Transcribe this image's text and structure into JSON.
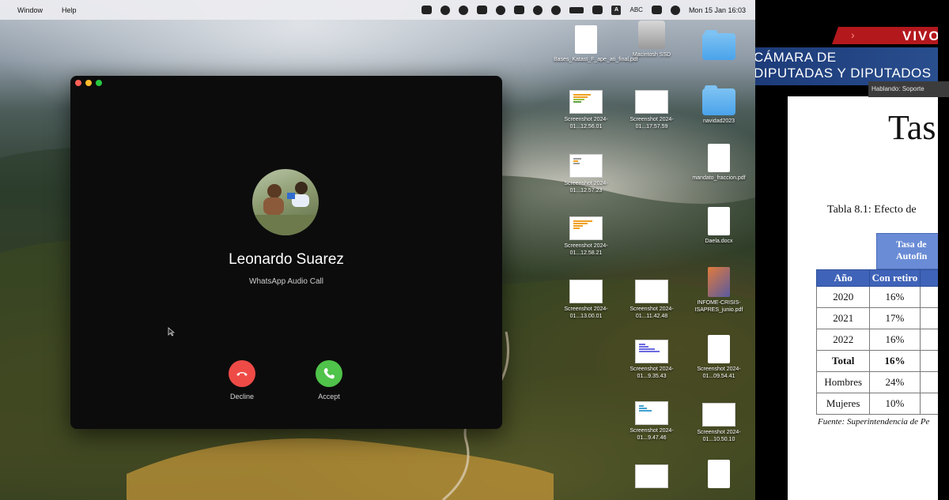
{
  "menubar": {
    "menus": [
      "Window",
      "Help"
    ],
    "input_source": "ABC",
    "clock": "Mon 15 Jan  16:03"
  },
  "call": {
    "caller_name": "Leonardo Suarez",
    "call_type": "WhatsApp Audio Call",
    "decline_label": "Decline",
    "accept_label": "Accept",
    "colors": {
      "decline": "#ee4b47",
      "accept": "#4fc34a"
    }
  },
  "desktop_icons": [
    {
      "kind": "doc",
      "label": "Bases_Katast_F_ape_ati_final.pdf"
    },
    {
      "kind": "drive",
      "label": "Macintosh SSD"
    },
    {
      "kind": "folder",
      "label": ""
    },
    {
      "kind": "shot",
      "label": "Screenshot 2024-01...12.56.01"
    },
    {
      "kind": "shot",
      "label": "Screenshot 2024-01...17.57.59"
    },
    {
      "kind": "folder",
      "label": "navidad2023"
    },
    {
      "kind": "shot",
      "label": "Screenshot 2024-01...12.57.23"
    },
    {
      "kind": "doc",
      "label": "mandato_fraccion.pdf"
    },
    {
      "kind": "shot",
      "label": "Screenshot 2024-01...12.58.21"
    },
    {
      "kind": "doc",
      "label": "Daela.docx"
    },
    {
      "kind": "shot",
      "label": "Screenshot 2024-01...13.00.01"
    },
    {
      "kind": "shot",
      "label": "Screenshot 2024-01...11.42.48"
    },
    {
      "kind": "pdfcover",
      "label": "INFOME-CRISIS-ISAPRES_junio.pdf"
    },
    {
      "kind": "shot",
      "label": "Screenshot 2024-01...9.35.43"
    },
    {
      "kind": "doc",
      "label": "Screenshot 2024-01...09.54.41"
    },
    {
      "kind": "shot",
      "label": "Screenshot 2024-01...9.47.46"
    },
    {
      "kind": "shot",
      "label": "Screenshot 2024-01...10.50.10"
    },
    {
      "kind": "shot",
      "label": ""
    },
    {
      "kind": "doc",
      "label": ""
    }
  ],
  "broadcast": {
    "live_label": "VIVO",
    "chamber_name": "CÁMARA DE\nDIPUTADAS Y DIPUTADOS",
    "speaking": "Hablando: Soporte",
    "colors": {
      "live": "#b3181d",
      "bar": "#1c3a78"
    }
  },
  "document": {
    "title_fragment": "Tas",
    "table_caption": "Tabla 8.1: Efecto de",
    "group_header": "Tasa de\nAutofin",
    "columns": [
      "Año",
      "Con retiro",
      ""
    ],
    "rows": [
      {
        "label": "2020",
        "value": "16%",
        "bold": false
      },
      {
        "label": "2021",
        "value": "17%",
        "bold": false
      },
      {
        "label": "2022",
        "value": "16%",
        "bold": false
      },
      {
        "label": "Total",
        "value": "16%",
        "bold": true
      },
      {
        "label": "Hombres",
        "value": "24%",
        "bold": false
      },
      {
        "label": "Mujeres",
        "value": "10%",
        "bold": false
      }
    ],
    "source": "Fuente: Superintendencia de Pe"
  }
}
